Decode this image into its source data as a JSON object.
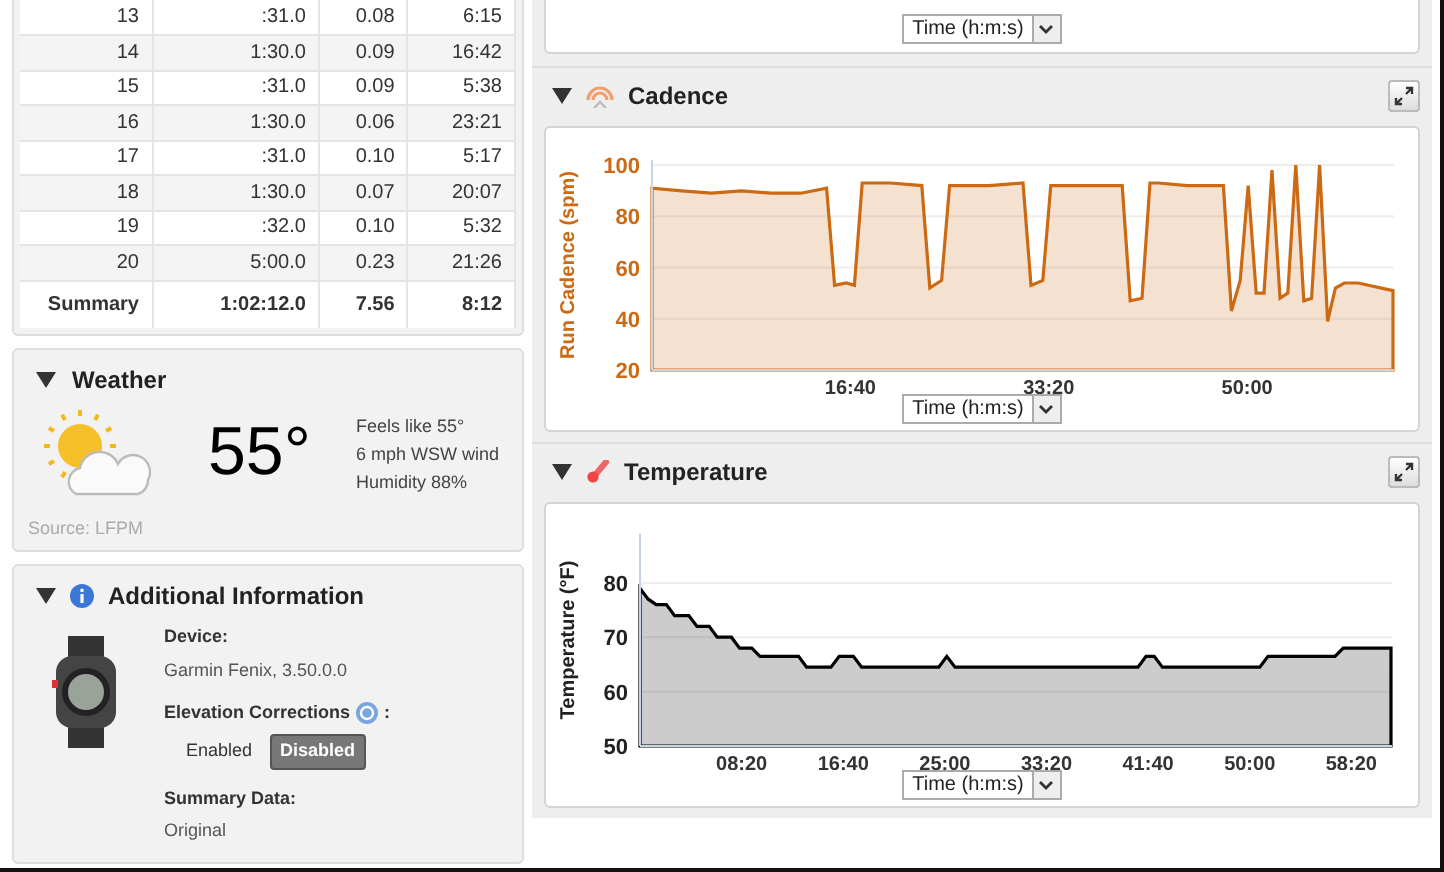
{
  "laps_table": {
    "rows": [
      {
        "cells": [
          "13",
          ":31.0",
          "0.08",
          "6:15"
        ]
      },
      {
        "cells": [
          "14",
          "1:30.0",
          "0.09",
          "16:42"
        ]
      },
      {
        "cells": [
          "15",
          ":31.0",
          "0.09",
          "5:38"
        ]
      },
      {
        "cells": [
          "16",
          "1:30.0",
          "0.06",
          "23:21"
        ]
      },
      {
        "cells": [
          "17",
          ":31.0",
          "0.10",
          "5:17"
        ]
      },
      {
        "cells": [
          "18",
          "1:30.0",
          "0.07",
          "20:07"
        ]
      },
      {
        "cells": [
          "19",
          ":32.0",
          "0.10",
          "5:32"
        ]
      },
      {
        "cells": [
          "20",
          "5:00.0",
          "0.23",
          "21:26"
        ]
      }
    ],
    "summary": [
      "Summary",
      "1:02:12.0",
      "7.56",
      "8:12"
    ]
  },
  "weather": {
    "title": "Weather",
    "temperature": "55°",
    "details": [
      "Feels like 55°",
      "6 mph WSW wind",
      "Humidity 88%"
    ],
    "source": "Source: LFPM"
  },
  "additional_information": {
    "title": "Additional Information",
    "device_label": "Device:",
    "device": "Garmin Fenix, 3.50.0.0",
    "elevation_label": "Elevation Corrections",
    "elevation_colon": ":",
    "elevation_options": [
      {
        "label": "Enabled",
        "selected": false
      },
      {
        "label": "Disabled",
        "selected": true
      }
    ],
    "summary_label": "Summary Data:",
    "summary_value": "Original"
  },
  "previous_chart": {
    "axis_select": "Time (h:m:s)"
  },
  "charts": [
    {
      "title": "Cadence",
      "kind": "cadence",
      "axis_select": "Time (h:m:s)",
      "chart_data": {
        "type": "area",
        "grid": true,
        "ylabel": "Run Cadence (spm)",
        "xlim": [
          0,
          3740
        ],
        "ylim": [
          20,
          102
        ],
        "yticks": [
          20,
          40,
          60,
          80,
          100
        ],
        "xticks": [
          {
            "value": 1000,
            "label": "16:40"
          },
          {
            "value": 2000,
            "label": "33:20"
          },
          {
            "value": 3000,
            "label": "50:00"
          }
        ],
        "x": [
          0,
          150,
          300,
          450,
          600,
          750,
          880,
          920,
          980,
          1020,
          1060,
          1200,
          1360,
          1400,
          1460,
          1500,
          1700,
          1870,
          1910,
          1970,
          2010,
          2050,
          2200,
          2370,
          2410,
          2470,
          2510,
          2550,
          2700,
          2880,
          2920,
          2965,
          3005,
          3045,
          3085,
          3125,
          3165,
          3205,
          3245,
          3285,
          3325,
          3365,
          3405,
          3445,
          3490,
          3560,
          3735
        ],
        "series": [
          {
            "color": "#cc6a14",
            "values": [
              91,
              90,
              89,
              90,
              89,
              89,
              91,
              53,
              54,
              53,
              93,
              93,
              92,
              52,
              55,
              92,
              92,
              93,
              53,
              55,
              92,
              92,
              92,
              92,
              47,
              48,
              93,
              93,
              92,
              92,
              43,
              55,
              92,
              50,
              50,
              98,
              48,
              50,
              100,
              47,
              48,
              100,
              39,
              52,
              54,
              54,
              51
            ]
          }
        ]
      }
    },
    {
      "title": "Temperature",
      "kind": "temperature",
      "axis_select": "Time (h:m:s)",
      "chart_data": {
        "type": "area",
        "grid": true,
        "ylabel": "Temperature (°F)",
        "xlim": [
          0,
          3700
        ],
        "ylim": [
          50,
          89
        ],
        "yticks": [
          50,
          60,
          70,
          80
        ],
        "xticks": [
          {
            "value": 500,
            "label": "08:20"
          },
          {
            "value": 1000,
            "label": "16:40"
          },
          {
            "value": 1500,
            "label": "25:00"
          },
          {
            "value": 2000,
            "label": "33:20"
          },
          {
            "value": 2500,
            "label": "41:40"
          },
          {
            "value": 3000,
            "label": "50:00"
          },
          {
            "value": 3500,
            "label": "58:20"
          }
        ],
        "x": [
          0,
          40,
          80,
          130,
          170,
          240,
          280,
          340,
          380,
          450,
          490,
          550,
          590,
          780,
          820,
          940,
          980,
          1050,
          1090,
          1470,
          1510,
          1550,
          2450,
          2490,
          2530,
          2570,
          3050,
          3090,
          3420,
          3460,
          3695
        ],
        "series": [
          {
            "color": "#000000",
            "values": [
              79,
              77,
              76,
              76,
              74,
              74,
              72,
              72,
              70,
              70,
              68,
              68,
              66.5,
              66.5,
              64.5,
              64.5,
              66.5,
              66.5,
              64.5,
              64.5,
              66.5,
              64.5,
              64.5,
              66.5,
              66.5,
              64.5,
              64.5,
              66.5,
              66.5,
              68,
              68
            ]
          }
        ]
      }
    }
  ]
}
